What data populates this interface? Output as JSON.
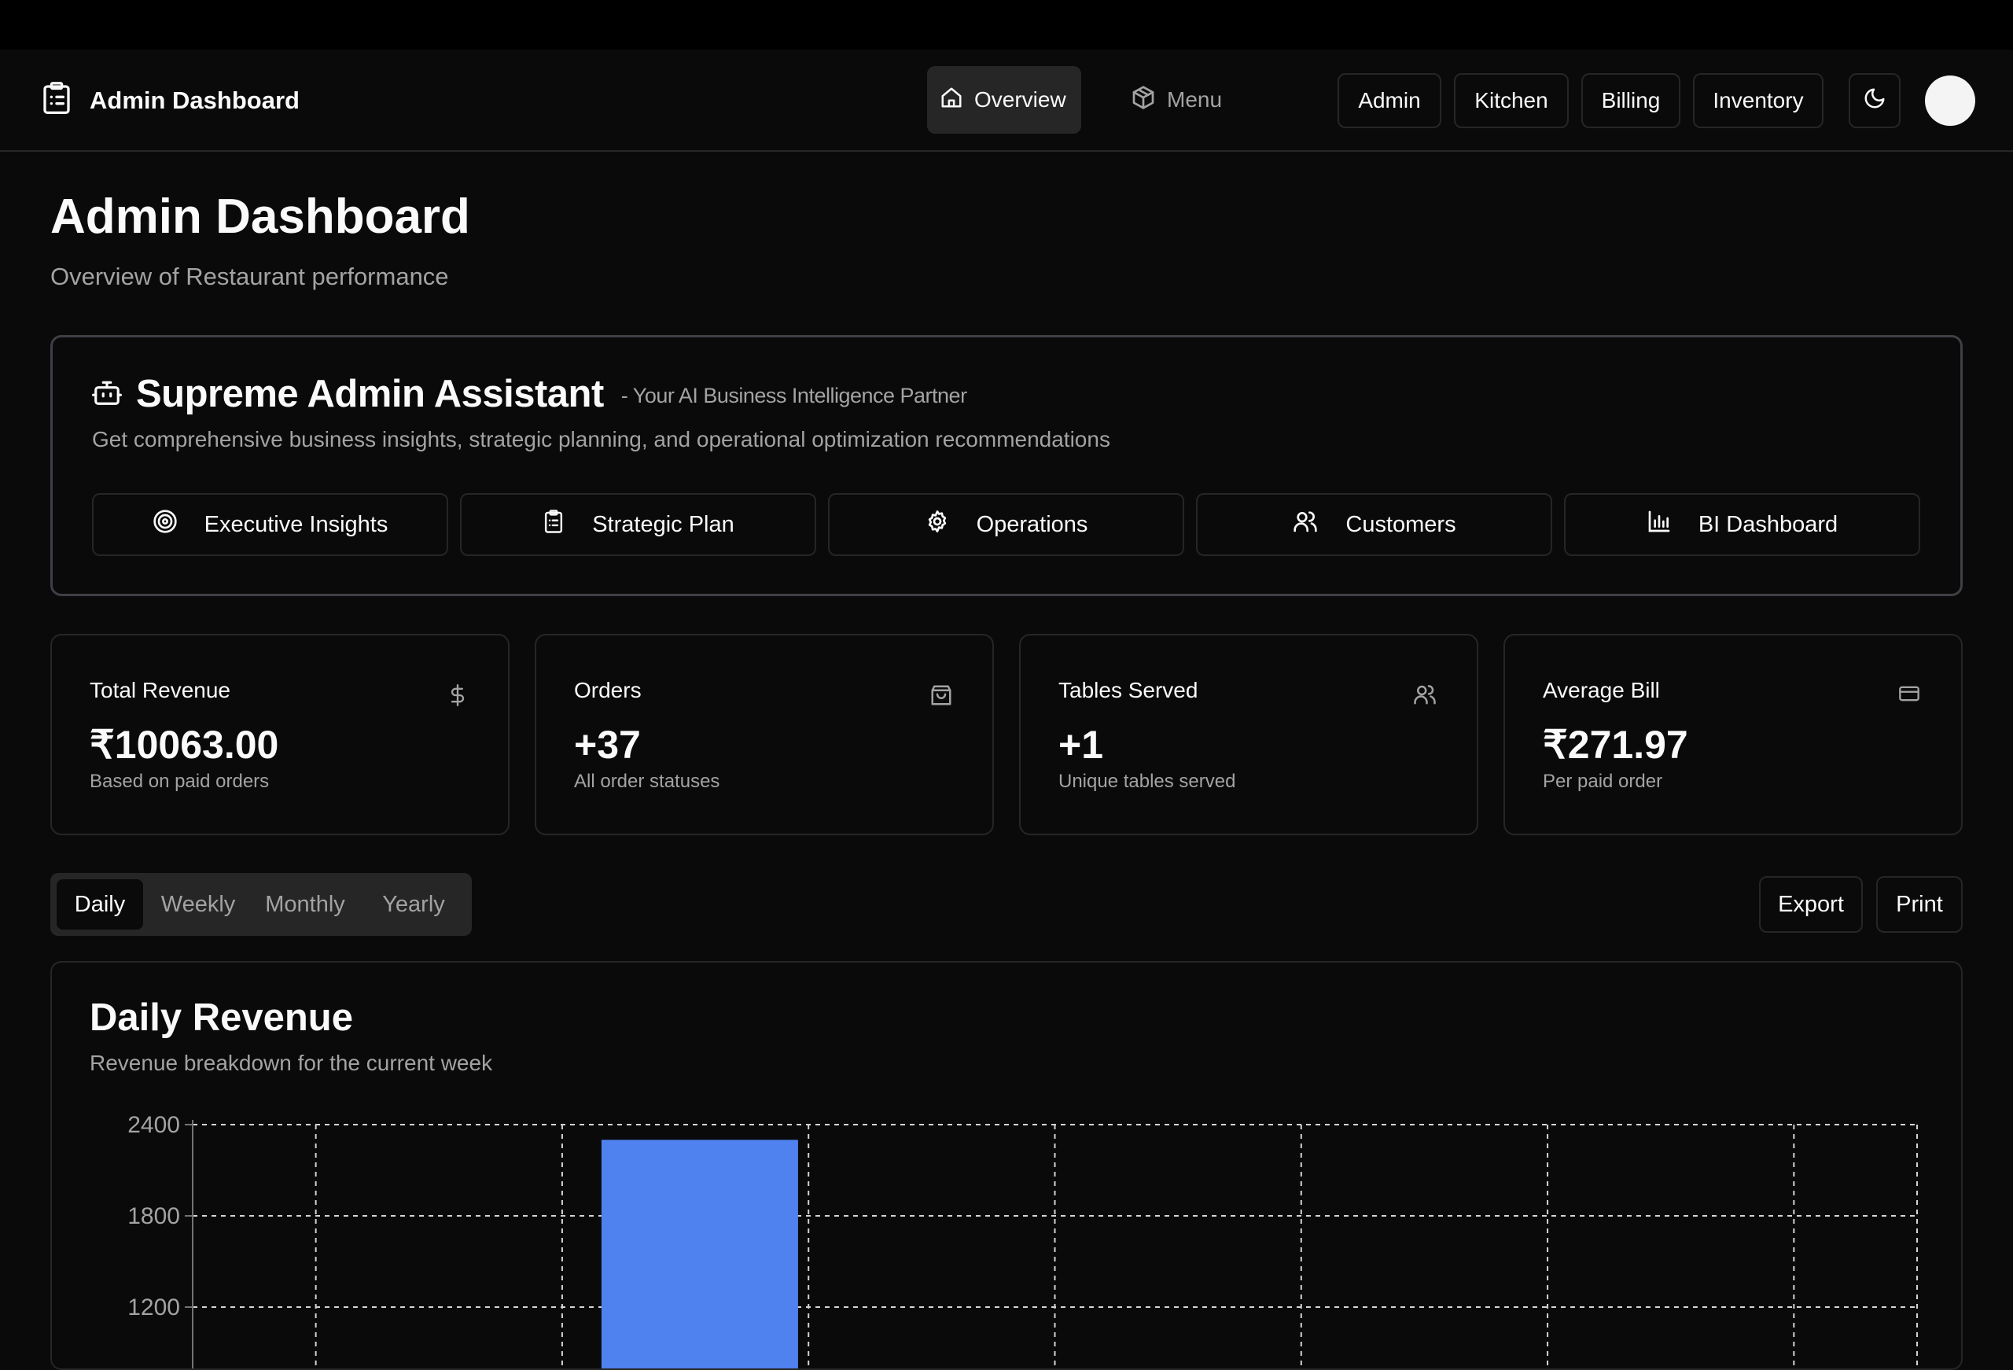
{
  "header": {
    "title": "Admin Dashboard",
    "logo_icon": "clipboard-list-icon",
    "nav": [
      {
        "label": "Overview",
        "icon": "home-icon",
        "active": true
      },
      {
        "label": "Menu",
        "icon": "package-icon",
        "active": false
      }
    ],
    "buttons": [
      "Admin",
      "Kitchen",
      "Billing",
      "Inventory"
    ],
    "theme_icon": "moon-icon"
  },
  "page": {
    "title": "Admin Dashboard",
    "subtitle": "Overview of Restaurant performance"
  },
  "assistant": {
    "title": "Supreme Admin Assistant",
    "tagline": "- Your AI Business Intelligence Partner",
    "description": "Get comprehensive business insights, strategic planning, and operational optimization recommendations",
    "actions": [
      {
        "label": "Executive Insights",
        "icon": "target-icon"
      },
      {
        "label": "Strategic Plan",
        "icon": "clipboard-list-icon"
      },
      {
        "label": "Operations",
        "icon": "gear-icon"
      },
      {
        "label": "Customers",
        "icon": "users-icon"
      },
      {
        "label": "BI Dashboard",
        "icon": "bar-chart-icon"
      }
    ]
  },
  "stats": [
    {
      "label": "Total Revenue",
      "value": "₹10063.00",
      "note": "Based on paid orders",
      "icon": "dollar-icon"
    },
    {
      "label": "Orders",
      "value": "+37",
      "note": "All order statuses",
      "icon": "shopping-bag-icon"
    },
    {
      "label": "Tables Served",
      "value": "+1",
      "note": "Unique tables served",
      "icon": "users-icon"
    },
    {
      "label": "Average Bill",
      "value": "₹271.97",
      "note": "Per paid order",
      "icon": "credit-card-icon"
    }
  ],
  "period_tabs": [
    {
      "label": "Daily",
      "active": true
    },
    {
      "label": "Weekly",
      "active": false
    },
    {
      "label": "Monthly",
      "active": false
    },
    {
      "label": "Yearly",
      "active": false
    }
  ],
  "actions": {
    "export": "Export",
    "print": "Print"
  },
  "chart": {
    "title": "Daily Revenue",
    "subtitle": "Revenue breakdown for the current week",
    "bar_color": "#4f81ef"
  },
  "chart_data": {
    "type": "bar",
    "title": "Daily Revenue",
    "categories": [
      "",
      "",
      "",
      "",
      "",
      "",
      ""
    ],
    "values": [
      0,
      2300,
      0,
      0,
      0,
      0,
      0
    ],
    "ylim": [
      0,
      2400
    ],
    "yticks": [
      2400,
      1800,
      1200
    ],
    "grid": true,
    "xlabel": "",
    "ylabel": ""
  }
}
